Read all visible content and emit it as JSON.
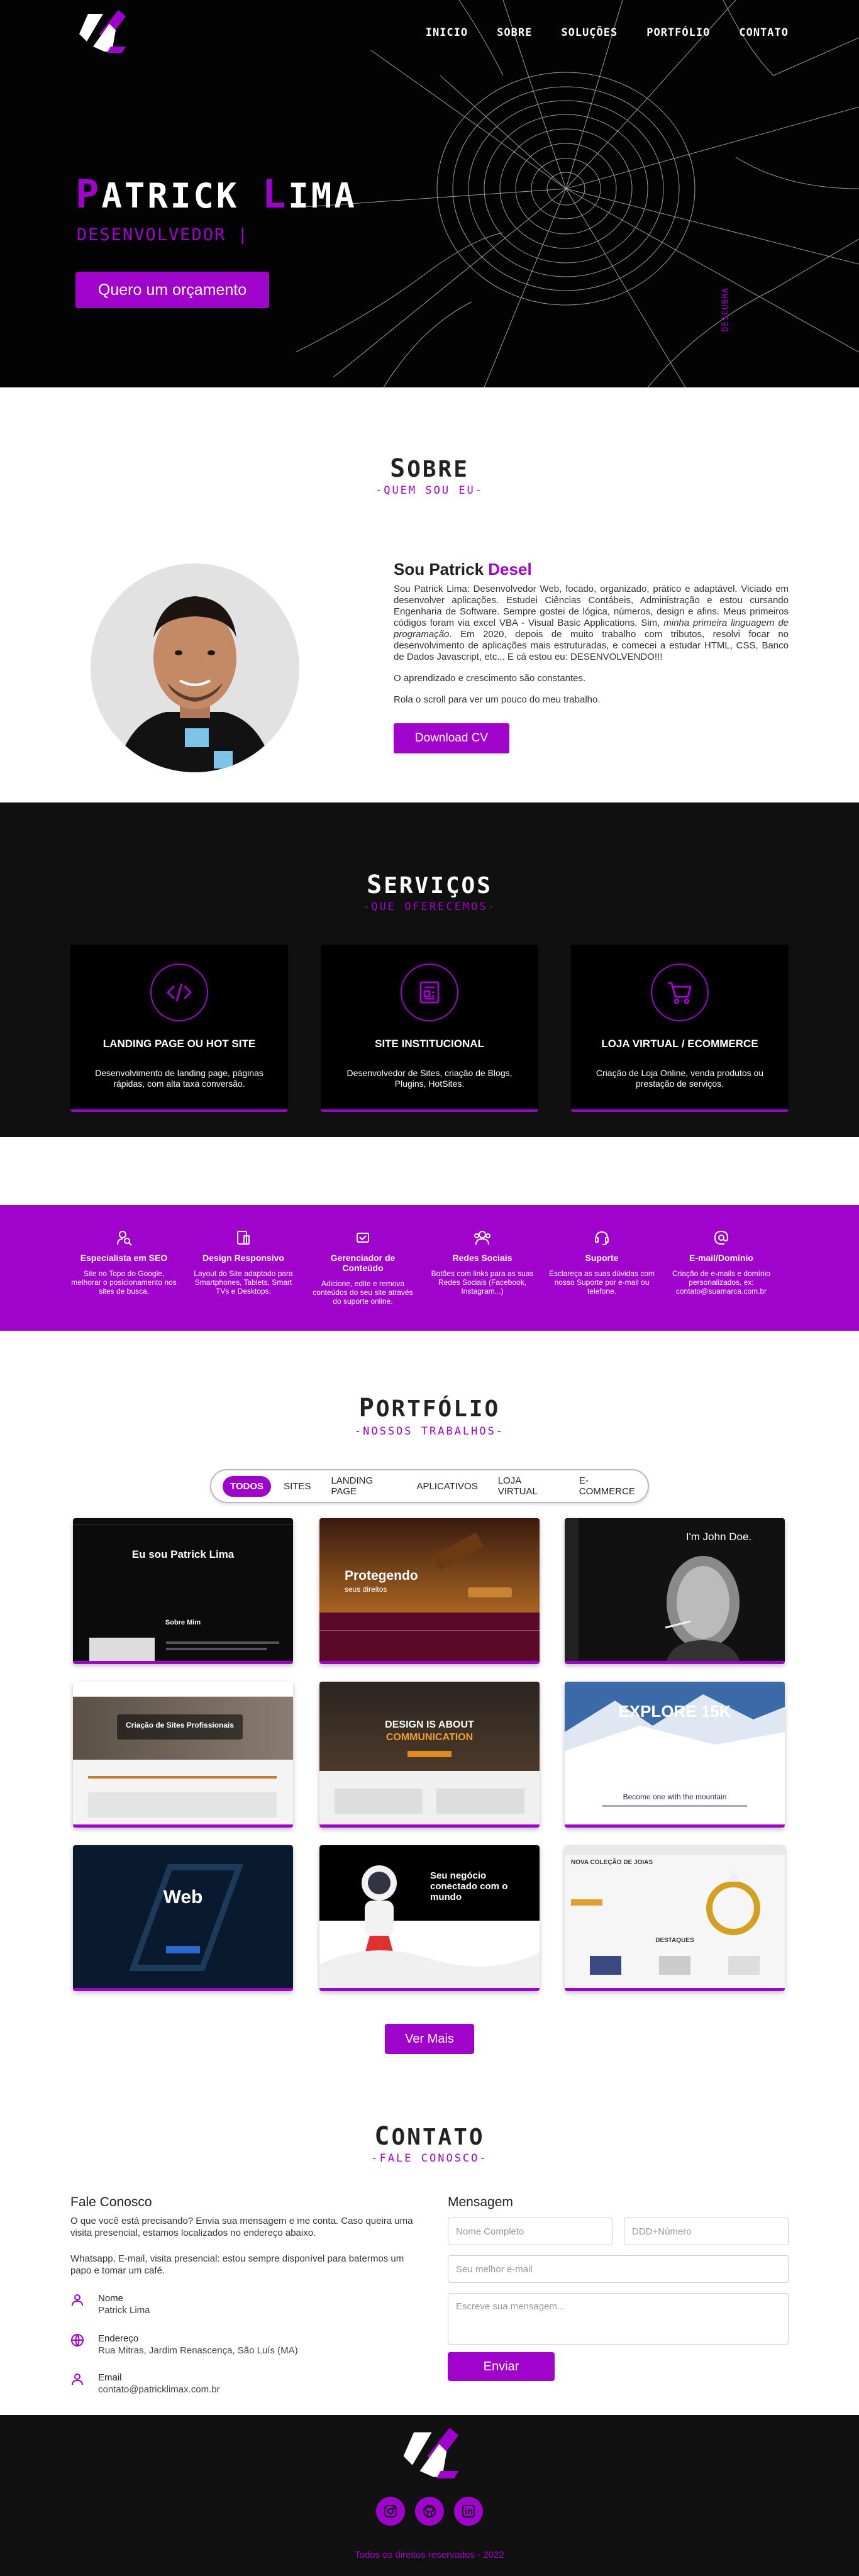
{
  "nav": [
    "INICIO",
    "SOBRE",
    "SOLUÇÕES",
    "PORTFÓLIO",
    "CONTATO"
  ],
  "hero": {
    "name_first_cap": "P",
    "name_first_rest": "ATRICK ",
    "name_last_cap": "L",
    "name_last_rest": "IMA",
    "role": "DESENVOLVEDOR |",
    "cta": "Quero um orçamento",
    "scroll_hint": "DESCUBRA"
  },
  "sobre": {
    "title_cap": "S",
    "title_rest": "OBRE",
    "subtitle": "-QUEM SOU EU-",
    "greeting": "Sou Patrick ",
    "greeting_accent": "Desel",
    "p1_a": "Sou Patrick Lima: Desenvolvedor Web, focado, organizado, prático e adaptável. Viciado em desenvolver aplicações. Estudei Ciências Contábeis, Administração e estou cursando Engenharia de Software. Sempre gostei de lógica, números, design e afins. Meus primeiros códigos foram via excel VBA - Visual Basic Applications. Sim, ",
    "p1_em": "minha primeira linguagem de programação",
    "p1_b": ". Em 2020, depois de muito trabalho com tributos, resolvi focar no desenvolvimento de aplicações mais estruturadas, e comecei a estudar HTML, CSS, Banco de Dados Javascript, etc... E cá estou eu: DESENVOLVENDO!!!",
    "p2": "O aprendizado e crescimento são constantes.",
    "p3": "Rola o scroll para ver um pouco do meu trabalho.",
    "cta": "Download CV"
  },
  "servicos": {
    "title_cap": "S",
    "title_rest": "ERVIÇOS",
    "subtitle": "-QUE OFERECEMOS-",
    "cards": [
      {
        "icon": "code-icon",
        "title": "LANDING PAGE OU HOT SITE",
        "desc": "Desenvolvimento de landing page, páginas rápidas, com alta taxa conversão."
      },
      {
        "icon": "layout-icon",
        "title": "SITE INSTITUCIONAL",
        "desc": "Desenvolvedor de Sites, criação de Blogs, Plugins, HotSites."
      },
      {
        "icon": "cart-icon",
        "title": "LOJA VIRTUAL / ECOMMERCE",
        "desc": "Criação de Loja Online, venda produtos ou prestação de serviços."
      }
    ]
  },
  "features": [
    {
      "icon": "user-search-icon",
      "title": "Especialista em SEO",
      "desc": "Site no Topo do Google, melhorar o posicionamento nos sites de busca."
    },
    {
      "icon": "responsive-icon",
      "title": "Design Responsivo",
      "desc": "Layout do Site adaptado para Smartphones, Tablets, Smart TVs e Desktops."
    },
    {
      "icon": "cms-icon",
      "title": "Gerenciador de Conteúdo",
      "desc": "Adicione, edite e remova conteúdos do seu site através do suporte online."
    },
    {
      "icon": "social-icon",
      "title": "Redes Sociais",
      "desc": "Botões com links para as suas Redes Sociais (Facebook, Instagram...)"
    },
    {
      "icon": "support-icon",
      "title": "Suporte",
      "desc": "Esclareça as suas dúvidas com nosso Suporte por e-mail ou telefone."
    },
    {
      "icon": "at-icon",
      "title": "E-mail/Domínio",
      "desc": "Criação de e-mails e domínio personalizados, ex: contato@suamarca.com.br"
    }
  ],
  "portfolio": {
    "title_cap": "P",
    "title_rest": "ORTFÓLIO",
    "subtitle": "-NOSSOS TRABALHOS-",
    "filters": [
      "TODOS",
      "SITES",
      "LANDING PAGE",
      "APLICATIVOS",
      "LOJA VIRTUAL",
      "E-COMMERCE"
    ],
    "items": [
      {
        "caption": "Eu sou Patrick Lima",
        "sub": "Sobre Mim"
      },
      {
        "caption": "Protegendo",
        "sub": "seus direitos"
      },
      {
        "caption": "I'm John Doe.",
        "sub": ""
      },
      {
        "caption": "Criação de Sites Profissionais",
        "sub": ""
      },
      {
        "caption": "DESIGN IS ABOUT",
        "sub": "COMMUNICATION"
      },
      {
        "caption": "EXPLORE 15K",
        "sub": "Become one with the mountain"
      },
      {
        "caption": "Web",
        "sub": ""
      },
      {
        "caption": "Seu negócio conectado com o mundo",
        "sub": ""
      },
      {
        "caption": "NOVA COLEÇÃO DE JOIAS",
        "sub": "DESTAQUES"
      }
    ],
    "more": "Ver Mais"
  },
  "contato": {
    "title_cap": "C",
    "title_rest": "ONTATO",
    "subtitle": "-FALE CONOSCO-",
    "left_head": "Fale Conosco",
    "p1": "O que você está precisando? Envia sua mensagem e me conta. Caso queira uma visita presencial, estamos localizados no endereço abaixo.",
    "p2": "Whatsapp, E-mail, visita presencial: estou sempre disponível para batermos um papo e tomar um café.",
    "name_label": "Nome",
    "name_value": "Patrick Lima",
    "addr_label": "Endereço",
    "addr_value": "Rua Mitras, Jardim Renascença, São Luís (MA)",
    "email_label": "Email",
    "email_value": "contato@patricklimax.com.br",
    "right_head": "Mensagem",
    "ph_name": "Nome Completo",
    "ph_phone": "DDD+Número",
    "ph_email": "Seu melhor e-mail",
    "ph_msg": "Escreve sua mensagem...",
    "send": "Enviar"
  },
  "footer": {
    "copyright": "Todos os direitos reservados - 2022"
  },
  "colors": {
    "accent": "#a004cc",
    "dark": "#030303"
  }
}
